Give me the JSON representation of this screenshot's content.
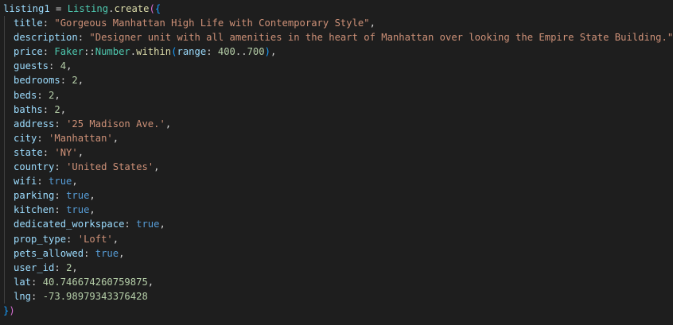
{
  "code": {
    "var_name": "listing1",
    "assign": " = ",
    "class_name": "Listing",
    "dot": ".",
    "method": "create",
    "open_paren": "(",
    "open_brace": "{",
    "close_brace": "}",
    "close_paren": ")",
    "lines": [
      {
        "key": "title",
        "value": "\"Gorgeous Manhattan High Life with Contemporary Style\"",
        "type": "str",
        "comma": ","
      },
      {
        "key": "description",
        "value": "\"Designer unit with all amenities in the heart of Manhattan over looking the Empire State Building.\"",
        "type": "str",
        "comma": ","
      },
      {
        "key": "price",
        "value": null,
        "type": "faker",
        "comma": ","
      },
      {
        "key": "guests",
        "value": "4",
        "type": "num",
        "comma": ","
      },
      {
        "key": "bedrooms",
        "value": "2",
        "type": "num",
        "comma": ","
      },
      {
        "key": "beds",
        "value": "2",
        "type": "num",
        "comma": ","
      },
      {
        "key": "baths",
        "value": "2",
        "type": "num",
        "comma": ","
      },
      {
        "key": "address",
        "value": "'25 Madison Ave.'",
        "type": "str",
        "comma": ","
      },
      {
        "key": "city",
        "value": "'Manhattan'",
        "type": "str",
        "comma": ","
      },
      {
        "key": "state",
        "value": "'NY'",
        "type": "str",
        "comma": ","
      },
      {
        "key": "country",
        "value": "'United States'",
        "type": "str",
        "comma": ","
      },
      {
        "key": "wifi",
        "value": "true",
        "type": "bool",
        "comma": ","
      },
      {
        "key": "parking",
        "value": "true",
        "type": "bool",
        "comma": ","
      },
      {
        "key": "kitchen",
        "value": "true",
        "type": "bool",
        "comma": ","
      },
      {
        "key": "dedicated_workspace",
        "value": "true",
        "type": "bool",
        "comma": ","
      },
      {
        "key": "prop_type",
        "value": "'Loft'",
        "type": "str",
        "comma": ","
      },
      {
        "key": "pets_allowed",
        "value": "true",
        "type": "bool",
        "comma": ","
      },
      {
        "key": "user_id",
        "value": "2",
        "type": "num",
        "comma": ","
      },
      {
        "key": "lat",
        "value": "40.746674260759875",
        "type": "num",
        "comma": ","
      },
      {
        "key": "lng",
        "value": "-73.98979343376428",
        "type": "num",
        "comma": ""
      }
    ],
    "faker": {
      "module": "Faker",
      "sep": "::",
      "cls": "Number",
      "dot": ".",
      "method": "within",
      "open": "(",
      "arg_key": "range",
      "range_start": "400",
      "range_op": "..",
      "range_end": "700",
      "close": ")"
    }
  },
  "colors": {
    "background": "#1e1e1e",
    "variable": "#9cdcfe",
    "class": "#4ec9b0",
    "function": "#dcdcaa",
    "string": "#ce9178",
    "number": "#b5cea8",
    "boolean": "#569cd6",
    "bracket_outer": "#da70d6",
    "bracket_inner": "#179fff"
  }
}
